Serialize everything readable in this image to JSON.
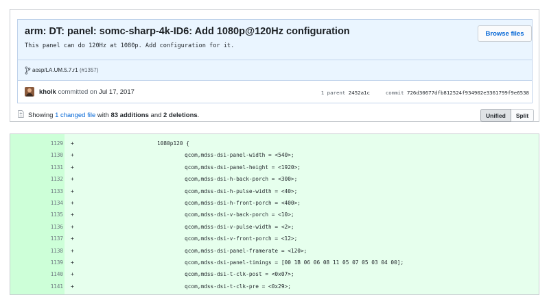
{
  "commit": {
    "title": "arm: DT: panel: somc-sharp-4k-ID6: Add 1080p@120Hz configuration",
    "description": "This panel can do 120Hz at 1080p. Add configuration for it.",
    "browse_files_label": "Browse files",
    "branch": "aosp/LA.UM.5.7.r1",
    "pr": "(#1357)",
    "author": "kholk",
    "committed_text": "committed on",
    "date": "Jul 17, 2017",
    "parent_count_label": "1 parent",
    "parent_sha": "2452a1c",
    "commit_label": "commit",
    "commit_sha": "726d30677dfb812524f934902e3361799f9e6538"
  },
  "summary": {
    "showing": "Showing",
    "changed_files": "1 changed file",
    "with": "with",
    "additions": "83 additions",
    "and": "and",
    "deletions": "2 deletions",
    "period": "."
  },
  "view_toggle": {
    "unified_label": "Unified",
    "split_label": "Split",
    "selected": "Unified"
  },
  "diff": {
    "marker": "+",
    "lines": [
      {
        "num": "1129",
        "code": "1080p120 {"
      },
      {
        "num": "1130",
        "code": "qcom,mdss-dsi-panel-width = <540>;"
      },
      {
        "num": "1131",
        "code": "qcom,mdss-dsi-panel-height = <1920>;"
      },
      {
        "num": "1132",
        "code": "qcom,mdss-dsi-h-back-porch = <300>;"
      },
      {
        "num": "1133",
        "code": "qcom,mdss-dsi-h-pulse-width = <40>;"
      },
      {
        "num": "1134",
        "code": "qcom,mdss-dsi-h-front-porch = <400>;"
      },
      {
        "num": "1135",
        "code": "qcom,mdss-dsi-v-back-porch = <10>;"
      },
      {
        "num": "1136",
        "code": "qcom,mdss-dsi-v-pulse-width = <2>;"
      },
      {
        "num": "1137",
        "code": "qcom,mdss-dsi-v-front-porch = <12>;"
      },
      {
        "num": "1138",
        "code": "qcom,mdss-dsi-panel-framerate = <120>;"
      },
      {
        "num": "1139",
        "code": "qcom,mdss-dsi-panel-timings = [00 1B 06 06 08 11 05 07 05 03 04 00];"
      },
      {
        "num": "1140",
        "code": "qcom,mdss-dsi-t-clk-post = <0x07>;"
      },
      {
        "num": "1141",
        "code": "qcom,mdss-dsi-t-clk-pre = <0x29>;"
      }
    ]
  },
  "colors": {
    "link": "#0366d6",
    "addition_bg": "#e6ffed",
    "addition_num_bg": "#cdffd8",
    "header_bg": "#eaf5ff"
  },
  "icons": {
    "branch": "git-branch-icon",
    "file": "file-diff-icon",
    "avatar": "user-avatar"
  }
}
